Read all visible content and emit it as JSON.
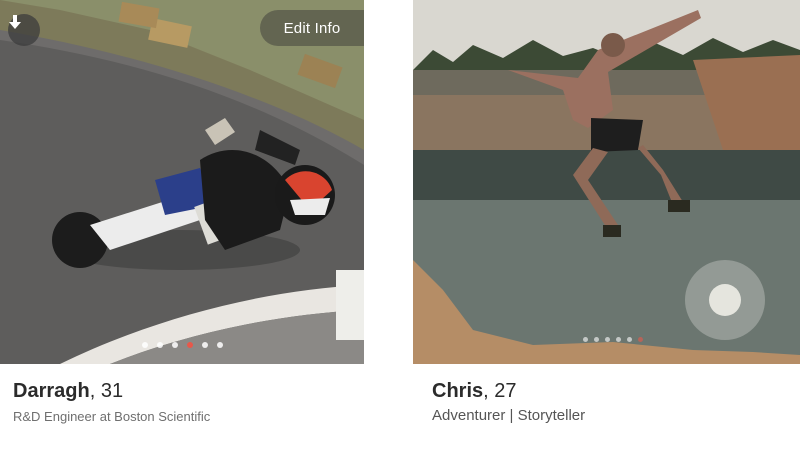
{
  "cards": [
    {
      "name": "Darragh",
      "age_text": ", 31",
      "subtitle": "R&D Engineer at Boston Scientific",
      "photo_count": 6,
      "active_photo_index": 3,
      "edit_label": "Edit Info",
      "icon": "download-icon"
    },
    {
      "name": "Chris",
      "age_text": ", 27",
      "subtitle": "Adventurer | Storyteller",
      "photo_count": 6,
      "active_photo_index": 5
    }
  ],
  "colors": {
    "active_dot": "#e8584a",
    "text_primary": "#2b2b2b",
    "text_secondary": "#6f6f6f"
  }
}
